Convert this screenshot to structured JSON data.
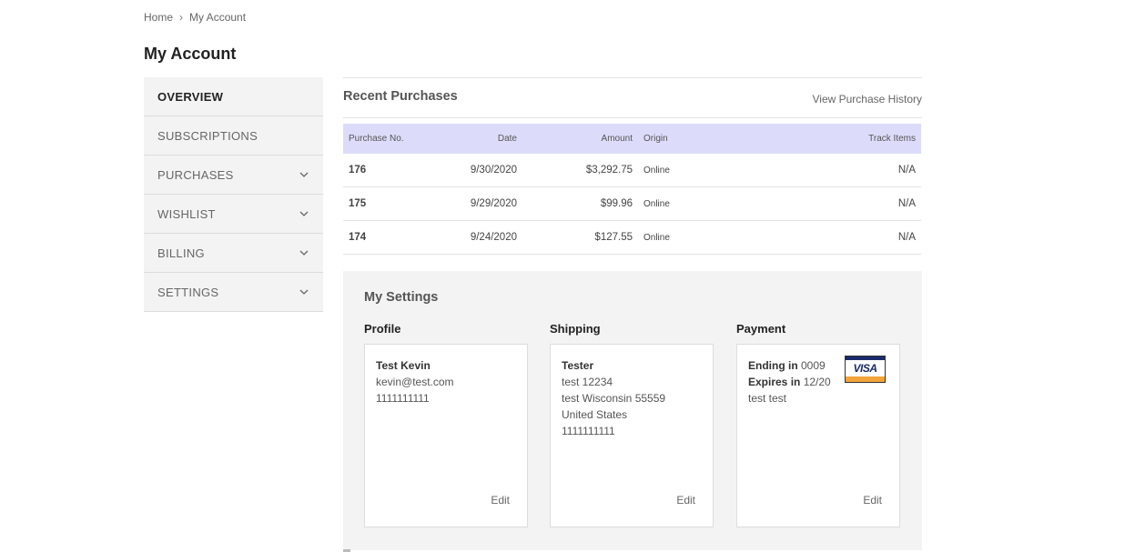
{
  "breadcrumb": {
    "home": "Home",
    "separator": "›",
    "current": "My Account"
  },
  "page_title": "My Account",
  "sidebar": {
    "items": [
      {
        "label": "OVERVIEW",
        "active": true,
        "expandable": false
      },
      {
        "label": "SUBSCRIPTIONS",
        "active": false,
        "expandable": false
      },
      {
        "label": "PURCHASES",
        "active": false,
        "expandable": true
      },
      {
        "label": "WISHLIST",
        "active": false,
        "expandable": true
      },
      {
        "label": "BILLING",
        "active": false,
        "expandable": true
      },
      {
        "label": "SETTINGS",
        "active": false,
        "expandable": true
      }
    ]
  },
  "recent_purchases": {
    "title": "Recent Purchases",
    "view_history_label": "View Purchase History",
    "columns": [
      "Purchase No.",
      "Date",
      "Amount",
      "Origin",
      "Track Items"
    ],
    "rows": [
      {
        "no": "176",
        "date": "9/30/2020",
        "amount": "$3,292.75",
        "origin": "Online",
        "track": "N/A"
      },
      {
        "no": "175",
        "date": "9/29/2020",
        "amount": "$99.96",
        "origin": "Online",
        "track": "N/A"
      },
      {
        "no": "174",
        "date": "9/24/2020",
        "amount": "$127.55",
        "origin": "Online",
        "track": "N/A"
      }
    ]
  },
  "settings": {
    "title": "My Settings",
    "profile": {
      "label": "Profile",
      "name": "Test Kevin",
      "email": "kevin@test.com",
      "phone": "1111111111",
      "edit": "Edit"
    },
    "shipping": {
      "label": "Shipping",
      "name": "Tester",
      "line1": "test 12234",
      "line2": "test Wisconsin 55559",
      "country": "United States",
      "phone": "1111111111",
      "edit": "Edit"
    },
    "payment": {
      "label": "Payment",
      "ending_label": "Ending in",
      "ending_value": "0009",
      "expires_label": "Expires in",
      "expires_value": "12/20",
      "holder": "test test",
      "card_brand": "VISA",
      "edit": "Edit"
    }
  },
  "colors": {
    "table_header_bg": "#dcdcfa",
    "panel_bg": "#f3f3f3",
    "visa_blue": "#1a2a6c",
    "visa_gold": "#f2a33a"
  }
}
